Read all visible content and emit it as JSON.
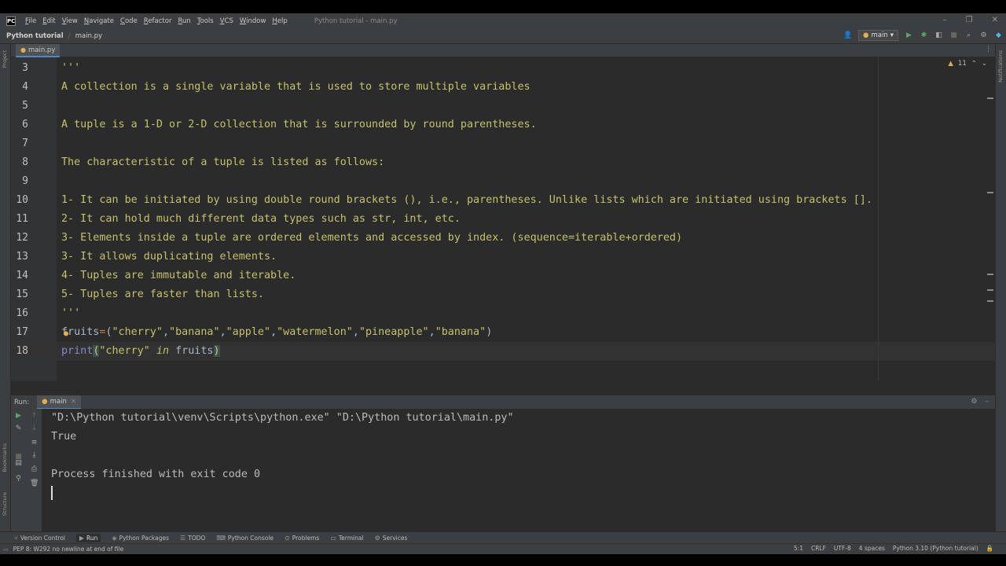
{
  "menu": [
    "File",
    "Edit",
    "View",
    "Navigate",
    "Code",
    "Refactor",
    "Run",
    "Tools",
    "VCS",
    "Window",
    "Help"
  ],
  "window_title": "Python tutorial - main.py",
  "breadcrumb": {
    "project": "Python tutorial",
    "file": "main.py"
  },
  "branch": "main",
  "editor_tab": "main.py",
  "inspection": {
    "warnings": "11"
  },
  "code_lines": [
    {
      "n": "3",
      "text": "'''"
    },
    {
      "n": "4",
      "text": "A collection is a single variable that is used to store multiple variables"
    },
    {
      "n": "5",
      "text": ""
    },
    {
      "n": "6",
      "text": "A tuple is a 1-D or 2-D collection that is surrounded by round parentheses."
    },
    {
      "n": "7",
      "text": ""
    },
    {
      "n": "8",
      "text": "The characteristic of a tuple is listed as follows:"
    },
    {
      "n": "9",
      "text": ""
    },
    {
      "n": "10",
      "text": "1- It can be initiated by using double round brackets (), i.e., parentheses. Unlike lists which are initiated using brackets []."
    },
    {
      "n": "11",
      "text": "2- It can hold much different data types such as str, int, etc."
    },
    {
      "n": "12",
      "text": "3- Elements inside a tuple are ordered elements and accessed by index. (sequence=iterable+ordered)"
    },
    {
      "n": "13",
      "text": "3- It allows duplicating elements."
    },
    {
      "n": "14",
      "text": "4- Tuples are immutable and iterable."
    },
    {
      "n": "15",
      "text": "5- Tuples are faster than lists."
    },
    {
      "n": "16",
      "text": "'''"
    },
    {
      "n": "17",
      "text": ""
    },
    {
      "n": "18",
      "text": ""
    }
  ],
  "line17": {
    "var": "fruits",
    "eq": "=",
    "open": "(",
    "items": [
      "\"cherry\"",
      "\"banana\"",
      "\"apple\"",
      "\"watermelon\"",
      "\"pineapple\"",
      "\"banana\""
    ],
    "sep": ",",
    "close": ")"
  },
  "line18": {
    "fn": "print",
    "open": "(",
    "str": "\"cherry\"",
    "kw": "in",
    "var": "fruits",
    "close": ")"
  },
  "run_panel": {
    "label": "Run:",
    "tab": "main"
  },
  "console_lines": [
    "\"D:\\Python tutorial\\venv\\Scripts\\python.exe\" \"D:\\Python tutorial\\main.py\"",
    "True",
    "",
    "Process finished with exit code 0"
  ],
  "tool_tabs": [
    "Version Control",
    "Run",
    "Python Packages",
    "TODO",
    "Python Console",
    "Problems",
    "Terminal",
    "Services"
  ],
  "status": {
    "message": "PEP 8: W292 no newline at end of file",
    "position": "5:1",
    "line_sep": "CRLF",
    "encoding": "UTF-8",
    "indent": "4 spaces",
    "interpreter": "Python 3.10 (Python tutorial)"
  },
  "side_labels": {
    "project": "Project",
    "bookmarks": "Bookmarks",
    "structure": "Structure",
    "notifications": "Notifications"
  }
}
